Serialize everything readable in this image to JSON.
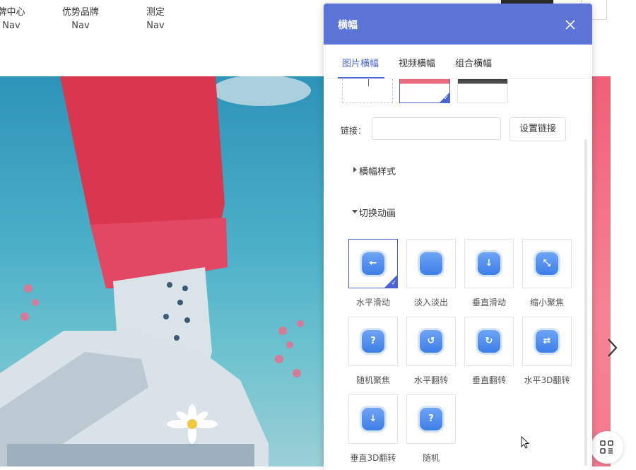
{
  "nav": [
    {
      "label": "牌中心",
      "sub": "Nav"
    },
    {
      "label": "优势品牌",
      "sub": "Nav"
    },
    {
      "label": "测定",
      "sub": "Nav"
    }
  ],
  "panel": {
    "title": "横幅",
    "tabs": [
      "图片横幅",
      "视频横幅",
      "组合横幅"
    ],
    "link_label": "链接：",
    "link_value": "",
    "link_button": "设置链接",
    "section_style": "横幅样式",
    "section_anim": "切换动画",
    "animations": [
      {
        "name": "水平滑动",
        "icon": "arrow-left-icon",
        "glyph": "←",
        "selected": true
      },
      {
        "name": "淡入淡出",
        "icon": "fade-icon",
        "glyph": "",
        "selected": false
      },
      {
        "name": "垂直滑动",
        "icon": "arrow-down-icon",
        "glyph": "↓",
        "selected": false
      },
      {
        "name": "缩小聚焦",
        "icon": "shrink-focus-icon",
        "glyph": "⤡",
        "selected": false
      },
      {
        "name": "随机聚焦",
        "icon": "random-focus-icon",
        "glyph": "?",
        "selected": false
      },
      {
        "name": "水平翻转",
        "icon": "horizontal-flip-icon",
        "glyph": "↺",
        "selected": false
      },
      {
        "name": "垂直翻转",
        "icon": "vertical-flip-icon",
        "glyph": "↻",
        "selected": false
      },
      {
        "name": "水平3D翻转",
        "icon": "horizontal-3d-flip-icon",
        "glyph": "⇄",
        "selected": false
      },
      {
        "name": "垂直3D翻转",
        "icon": "vertical-3d-flip-icon",
        "glyph": "↓",
        "selected": false
      },
      {
        "name": "随机",
        "icon": "random-icon",
        "glyph": "?",
        "selected": false
      }
    ]
  },
  "colors": {
    "accent": "#4a66d4",
    "header": "#5b74d6"
  }
}
